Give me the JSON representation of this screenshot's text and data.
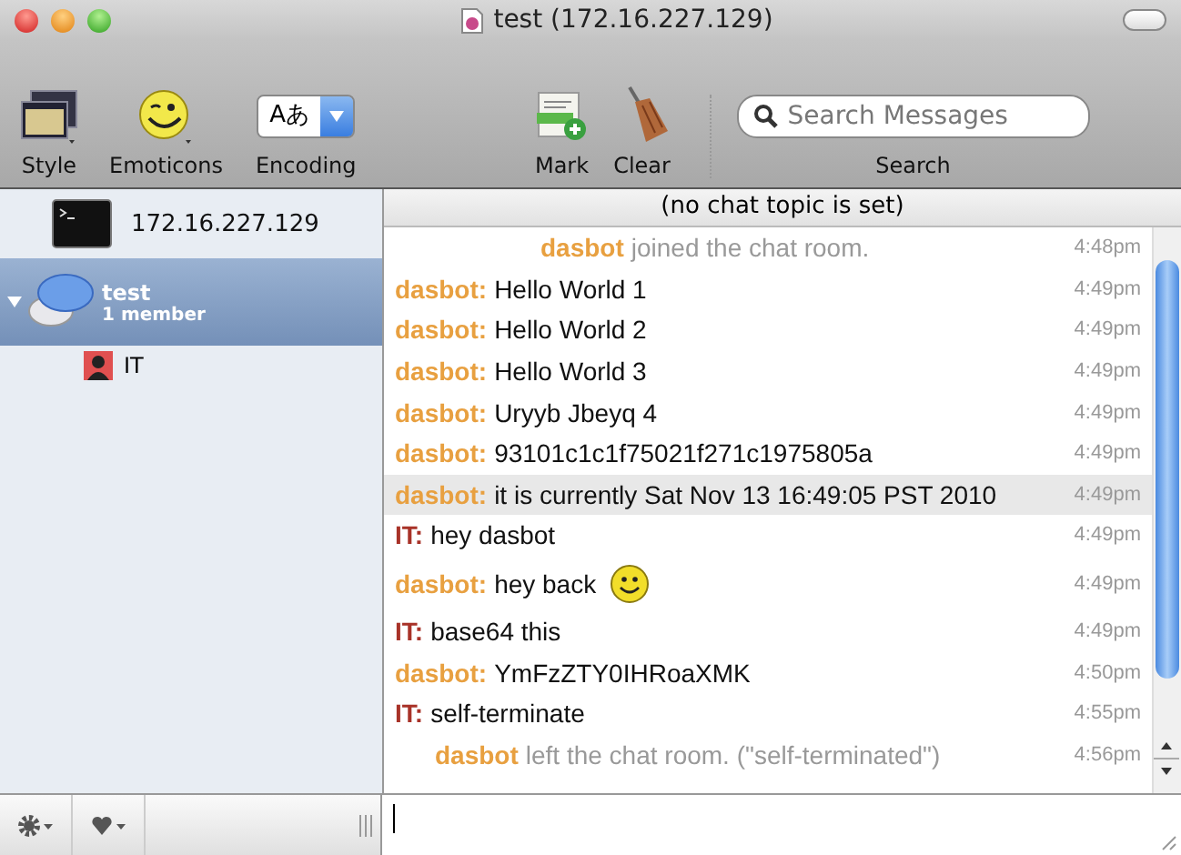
{
  "window": {
    "title": "test (172.16.227.129)"
  },
  "toolbar": {
    "items": [
      {
        "kind": "style",
        "label": "Style"
      },
      {
        "kind": "emoticons",
        "label": "Emoticons"
      },
      {
        "kind": "encoding",
        "label": "Encoding",
        "value": "Aあ"
      },
      {
        "kind": "mark",
        "label": "Mark"
      },
      {
        "kind": "clear",
        "label": "Clear"
      },
      {
        "kind": "search",
        "label": "Search",
        "placeholder": "Search Messages"
      }
    ]
  },
  "sidebar": {
    "items": [
      {
        "kind": "console",
        "label": "172.16.227.129",
        "selected": false
      },
      {
        "kind": "chat",
        "label": "test",
        "sublabel": "1 member",
        "selected": true,
        "expanded": true,
        "children": [
          {
            "label": "IT",
            "selected": false
          }
        ]
      }
    ]
  },
  "chat": {
    "topic": "(no chat topic is set)",
    "messages": [
      {
        "kind": "event",
        "sender": "dasbot",
        "text": "joined the chat room.",
        "time": "4:48pm",
        "color": "#e8a040",
        "selected": false
      },
      {
        "kind": "message",
        "sender": "dasbot:",
        "text": "Hello World 1",
        "time": "4:49pm",
        "color": "#e8a040",
        "selected": false
      },
      {
        "kind": "message",
        "sender": "dasbot:",
        "text": "Hello World 2",
        "time": "4:49pm",
        "color": "#e8a040",
        "selected": false
      },
      {
        "kind": "message",
        "sender": "dasbot:",
        "text": "Hello World 3",
        "time": "4:49pm",
        "color": "#e8a040",
        "selected": false
      },
      {
        "kind": "message",
        "sender": "dasbot:",
        "text": "Uryyb Jbeyq 4",
        "time": "4:49pm",
        "color": "#e8a040",
        "selected": false
      },
      {
        "kind": "message",
        "sender": "dasbot:",
        "text": "93101c1c1f75021f271c1975805a",
        "time": "4:49pm",
        "color": "#e8a040",
        "selected": false
      },
      {
        "kind": "message",
        "sender": "dasbot:",
        "text": "it is currently Sat Nov 13 16:49:05 PST 2010",
        "time": "4:49pm",
        "color": "#e8a040",
        "selected": true
      },
      {
        "kind": "message",
        "sender": "IT:",
        "text": "hey dasbot",
        "time": "4:49pm",
        "color": "#a83228",
        "selected": false
      },
      {
        "kind": "message",
        "sender": "dasbot:",
        "text": "hey back",
        "emoticon": true,
        "time": "4:49pm",
        "color": "#e8a040",
        "selected": false
      },
      {
        "kind": "message",
        "sender": "IT:",
        "text": "base64 this",
        "time": "4:49pm",
        "color": "#a83228",
        "selected": false
      },
      {
        "kind": "message",
        "sender": "dasbot:",
        "text": "YmFzZTY0IHRoaXMK",
        "time": "4:50pm",
        "color": "#e8a040",
        "selected": false
      },
      {
        "kind": "message",
        "sender": "IT:",
        "text": "self-terminate",
        "time": "4:55pm",
        "color": "#a83228",
        "selected": false
      },
      {
        "kind": "event",
        "sender": "dasbot",
        "text": "left the chat room. (\"self-terminated\")",
        "time": "4:56pm",
        "color": "#e8a040",
        "selected": false
      }
    ]
  }
}
